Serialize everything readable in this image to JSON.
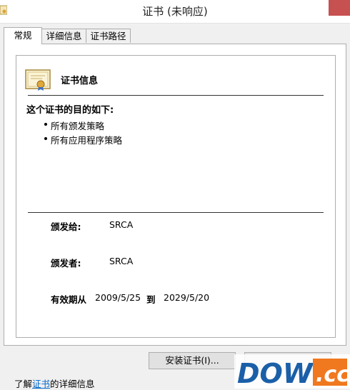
{
  "window": {
    "title": "证书 (未响应)"
  },
  "tabs": [
    {
      "label": "常规",
      "active": true
    },
    {
      "label": "详细信息",
      "active": false
    },
    {
      "label": "证书路径",
      "active": false
    }
  ],
  "general": {
    "heading": "证书信息",
    "purpose_heading": "这个证书的目的如下:",
    "purposes": [
      "所有颁发策略",
      "所有应用程序策略"
    ],
    "issued_to_label": "颁发给:",
    "issued_to_value": "SRCA",
    "issued_by_label": "颁发者:",
    "issued_by_value": "SRCA",
    "valid_from_label": "有效期从",
    "valid_from": "2009/5/25",
    "valid_to_label": "到",
    "valid_to": "2029/5/20"
  },
  "buttons": {
    "install": "安装证书(I)..."
  },
  "footer": {
    "prefix": "了解",
    "link": "证书",
    "suffix": "的详细信息"
  },
  "watermark": {
    "text": "DOWN.cc"
  },
  "colors": {
    "close": "#c75050",
    "link": "#0066cc",
    "watermark_blue": "#1a5fa8",
    "watermark_orange": "#f0781e"
  }
}
